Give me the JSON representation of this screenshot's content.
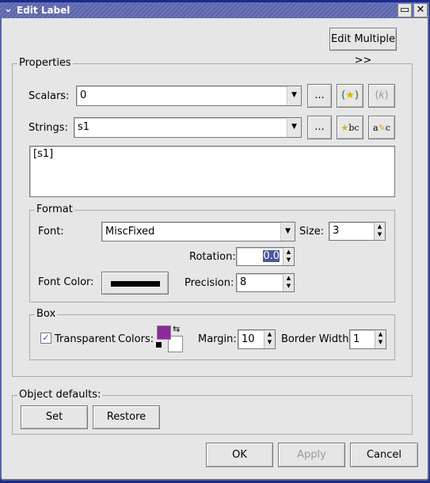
{
  "window": {
    "title": "Edit Label"
  },
  "edit_multiple_label": "Edit Multiple >>",
  "properties": {
    "label": "Properties",
    "scalars_label": "Scalars:",
    "scalars_value": "0",
    "strings_label": "Strings:",
    "strings_value": "s1",
    "browse_label": "...",
    "text_value": "[s1]"
  },
  "format": {
    "label": "Format",
    "font_label": "Font:",
    "font_value": "MiscFixed",
    "size_label": "Size:",
    "size_value": "3",
    "rotation_label": "Rotation:",
    "rotation_value": "0.0",
    "font_color_label": "Font Color:",
    "font_color": "#000000",
    "precision_label": "Precision:",
    "precision_value": "8"
  },
  "box": {
    "label": "Box",
    "transparent_label": "Transparent",
    "transparent_checked": true,
    "colors_label": "Colors:",
    "foreground_color": "#8b2a99",
    "background_color": "#ffffff",
    "margin_label": "Margin:",
    "margin_value": "10",
    "border_width_label": "Border Width:",
    "border_width_value": "1"
  },
  "defaults": {
    "label": "Object defaults:",
    "set_label": "Set",
    "restore_label": "Restore"
  },
  "footer": {
    "ok_label": "OK",
    "apply_label": "Apply",
    "cancel_label": "Cancel"
  }
}
